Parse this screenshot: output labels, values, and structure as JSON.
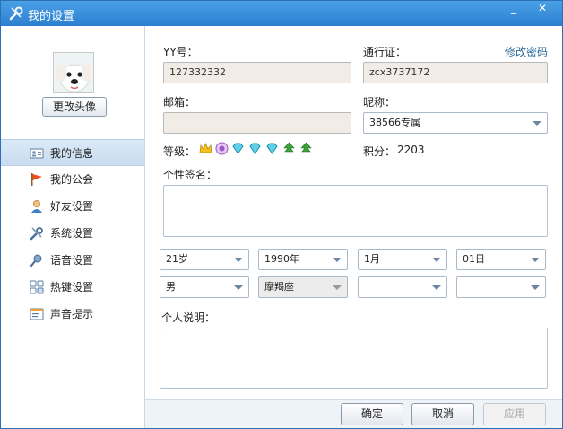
{
  "window": {
    "title": "我的设置",
    "minimize": "_",
    "close": "✕"
  },
  "sidebar": {
    "change_avatar": "更改头像",
    "items": [
      {
        "label": "我的信息",
        "icon": "card-icon"
      },
      {
        "label": "我的公会",
        "icon": "flag-icon"
      },
      {
        "label": "好友设置",
        "icon": "user-icon"
      },
      {
        "label": "系统设置",
        "icon": "wrench-icon"
      },
      {
        "label": "语音设置",
        "icon": "microphone-icon"
      },
      {
        "label": "热键设置",
        "icon": "keyboard-icon"
      },
      {
        "label": "声音提示",
        "icon": "notification-icon"
      }
    ]
  },
  "form": {
    "yy_label": "YY号：",
    "yy_value": "127332332",
    "pass_label": "通行证：",
    "pass_value": "zcx3737172",
    "change_password": "修改密码",
    "email_label": "邮箱：",
    "email_value": "",
    "nickname_label": "昵称：",
    "nickname_value": "38566专属",
    "level_label": "等级：",
    "points_label": "积分：",
    "points_value": "2203",
    "signature_label": "个性签名：",
    "age": "21岁",
    "year": "1990年",
    "month": "1月",
    "day": "01日",
    "gender": "男",
    "zodiac": "摩羯座",
    "blank1": "",
    "blank2": "",
    "desc_label": "个人说明："
  },
  "footer": {
    "ok": "确定",
    "cancel": "取消",
    "apply": "应用"
  },
  "colors": {
    "titlebar": "#2c7fd0",
    "nav_active": "#c9dcf0",
    "link": "#2b6a9c"
  }
}
